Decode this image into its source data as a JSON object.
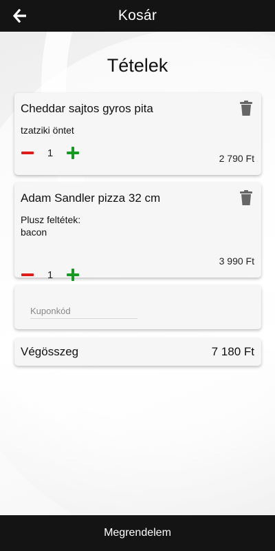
{
  "header": {
    "title": "Kosár",
    "back_icon": "arrow-left-icon"
  },
  "main": {
    "title": "Tételek",
    "items": [
      {
        "name": "Cheddar sajtos gyros pita",
        "extra_line1": "tzatziki öntet",
        "extra_line2": "",
        "quantity": "1",
        "price": "2 790 Ft",
        "delete_icon": "trash-icon"
      },
      {
        "name": "Adam Sandler pizza 32 cm",
        "extra_line1": "Plusz feltétek:",
        "extra_line2": "bacon",
        "quantity": "1",
        "price": "3 990 Ft",
        "delete_icon": "trash-icon"
      }
    ],
    "coupon": {
      "placeholder": "Kuponkód",
      "value": ""
    },
    "total": {
      "label": "Végösszeg",
      "value": "7 180 Ft"
    }
  },
  "footer": {
    "order_label": "Megrendelem"
  },
  "colors": {
    "bar": "#141414",
    "minus": "#e01b1b",
    "plus": "#159a22",
    "trash": "#666666"
  }
}
